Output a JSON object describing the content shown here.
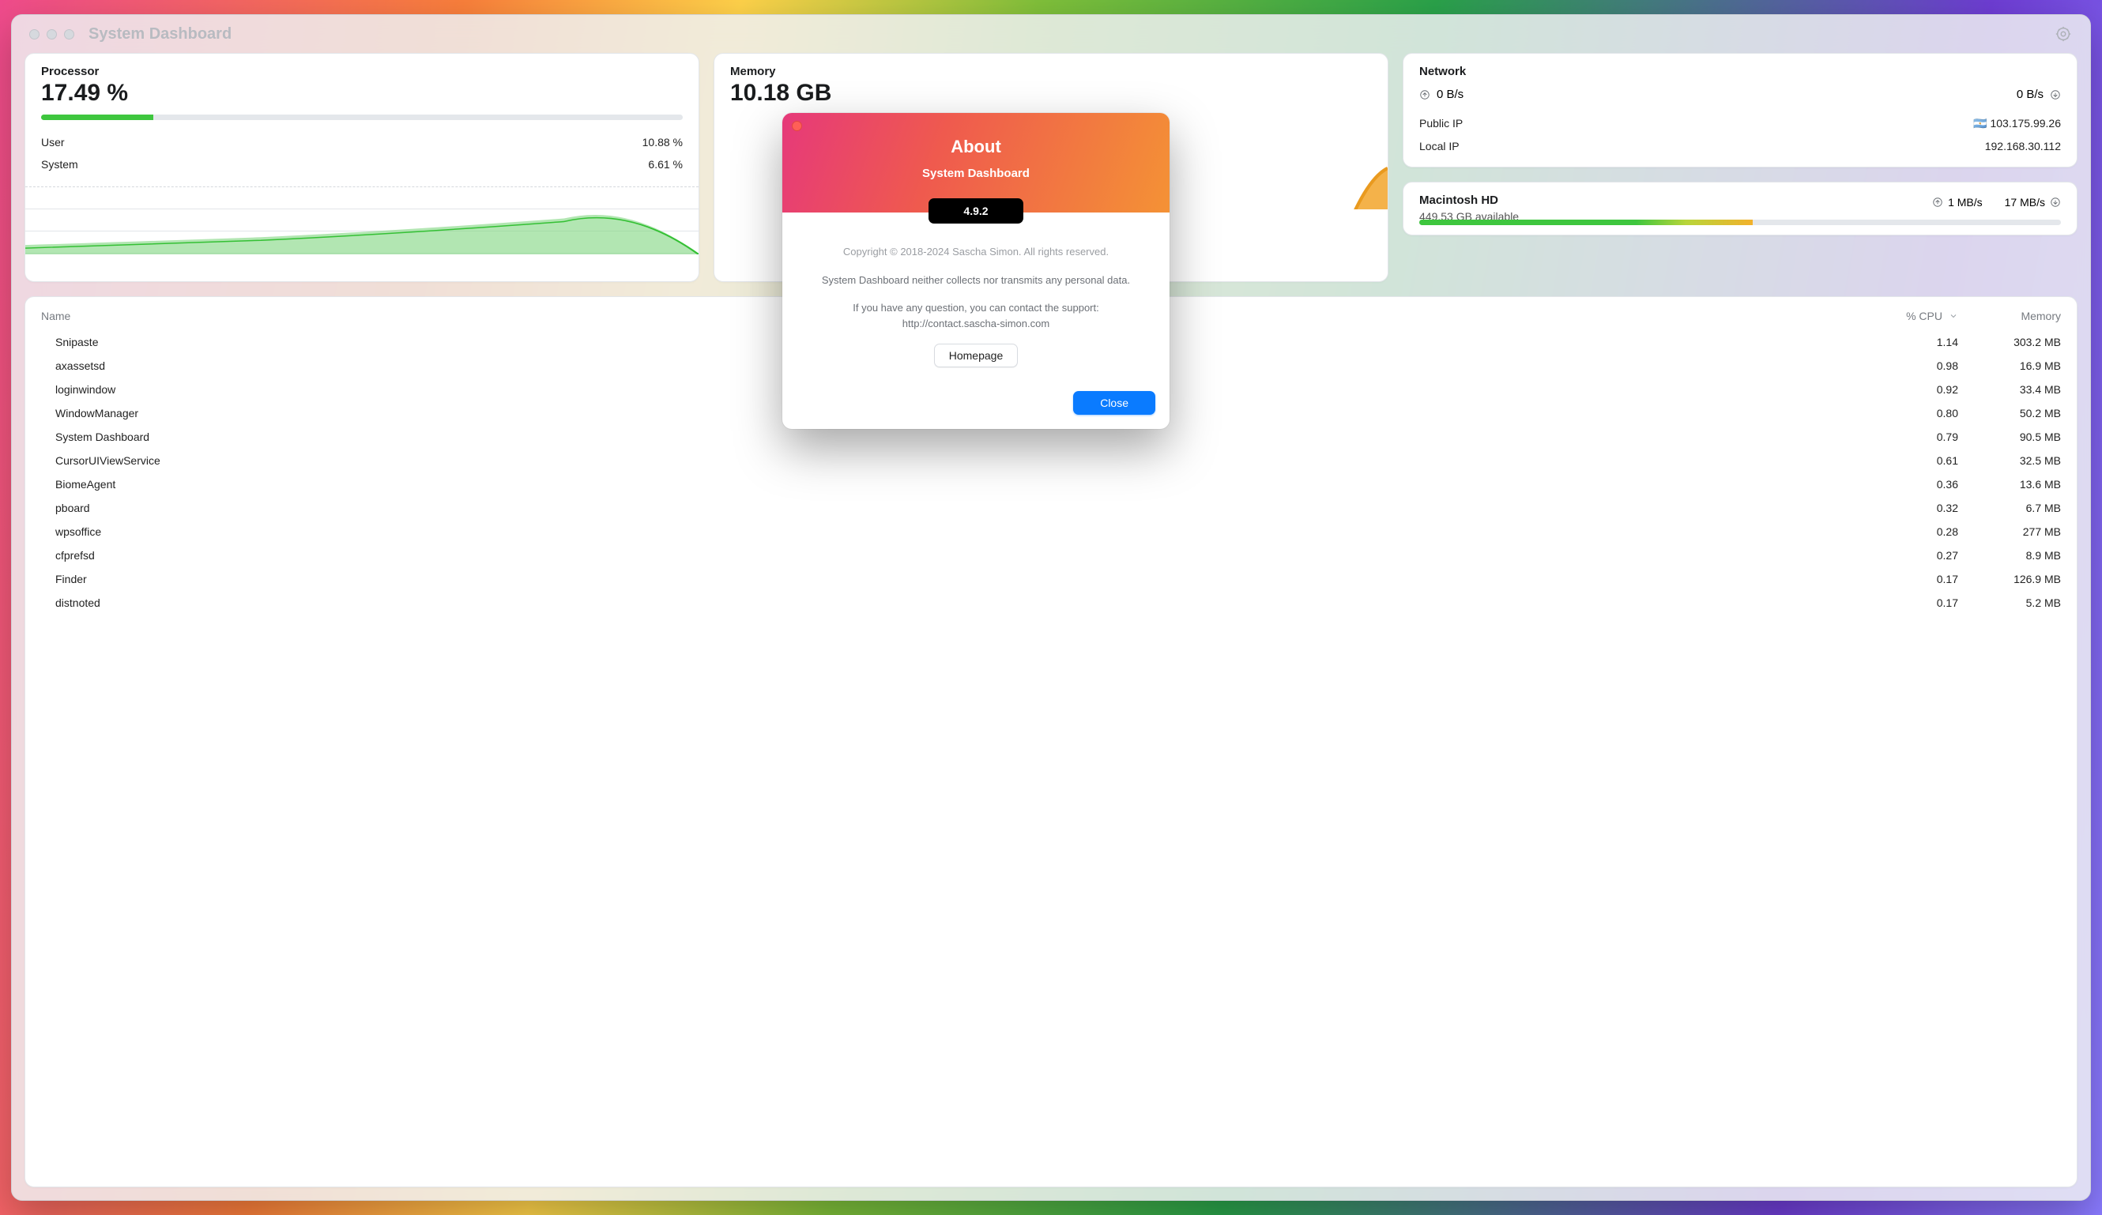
{
  "window": {
    "title": "System Dashboard"
  },
  "processor": {
    "title": "Processor",
    "value": "17.49 %",
    "bar_pct": 17.5,
    "user_label": "User",
    "user_value": "10.88 %",
    "system_label": "System",
    "system_value": "6.61 %"
  },
  "memory": {
    "title": "Memory",
    "value": "10.18 GB"
  },
  "network": {
    "title": "Network",
    "up_value": "0 B/s",
    "down_value": "0 B/s",
    "public_ip_label": "Public IP",
    "public_ip_value": "103.175.99.26",
    "public_ip_flag": "🇦🇷",
    "local_ip_label": "Local IP",
    "local_ip_value": "192.168.30.112"
  },
  "disk": {
    "title": "Macintosh HD",
    "available": "449.53 GB available",
    "read_value": "1 MB/s",
    "write_value": "17 MB/s",
    "bar_pct": 52
  },
  "table": {
    "col_name": "Name",
    "col_cpu": "% CPU",
    "col_mem": "Memory",
    "rows": [
      {
        "name": "Snipaste",
        "cpu": "1.14",
        "mem": "303.2 MB"
      },
      {
        "name": "axassetsd",
        "cpu": "0.98",
        "mem": "16.9 MB"
      },
      {
        "name": "loginwindow",
        "cpu": "0.92",
        "mem": "33.4 MB"
      },
      {
        "name": "WindowManager",
        "cpu": "0.80",
        "mem": "50.2 MB"
      },
      {
        "name": "System Dashboard",
        "cpu": "0.79",
        "mem": "90.5 MB"
      },
      {
        "name": "CursorUIViewService",
        "cpu": "0.61",
        "mem": "32.5 MB"
      },
      {
        "name": "BiomeAgent",
        "cpu": "0.36",
        "mem": "13.6 MB"
      },
      {
        "name": "pboard",
        "cpu": "0.32",
        "mem": "6.7 MB"
      },
      {
        "name": "wpsoffice",
        "cpu": "0.28",
        "mem": "277 MB"
      },
      {
        "name": "cfprefsd",
        "cpu": "0.27",
        "mem": "8.9 MB"
      },
      {
        "name": "Finder",
        "cpu": "0.17",
        "mem": "126.9 MB"
      },
      {
        "name": "distnoted",
        "cpu": "0.17",
        "mem": "5.2 MB"
      }
    ]
  },
  "about": {
    "title": "About",
    "app": "System Dashboard",
    "version": "4.9.2",
    "copyright": "Copyright © 2018-2024 Sascha Simon. All rights reserved.",
    "privacy": "System Dashboard neither collects nor transmits any personal data.",
    "support": "If you have any question, you can contact the support: http://contact.sascha-simon.com",
    "homepage_label": "Homepage",
    "close_label": "Close"
  }
}
